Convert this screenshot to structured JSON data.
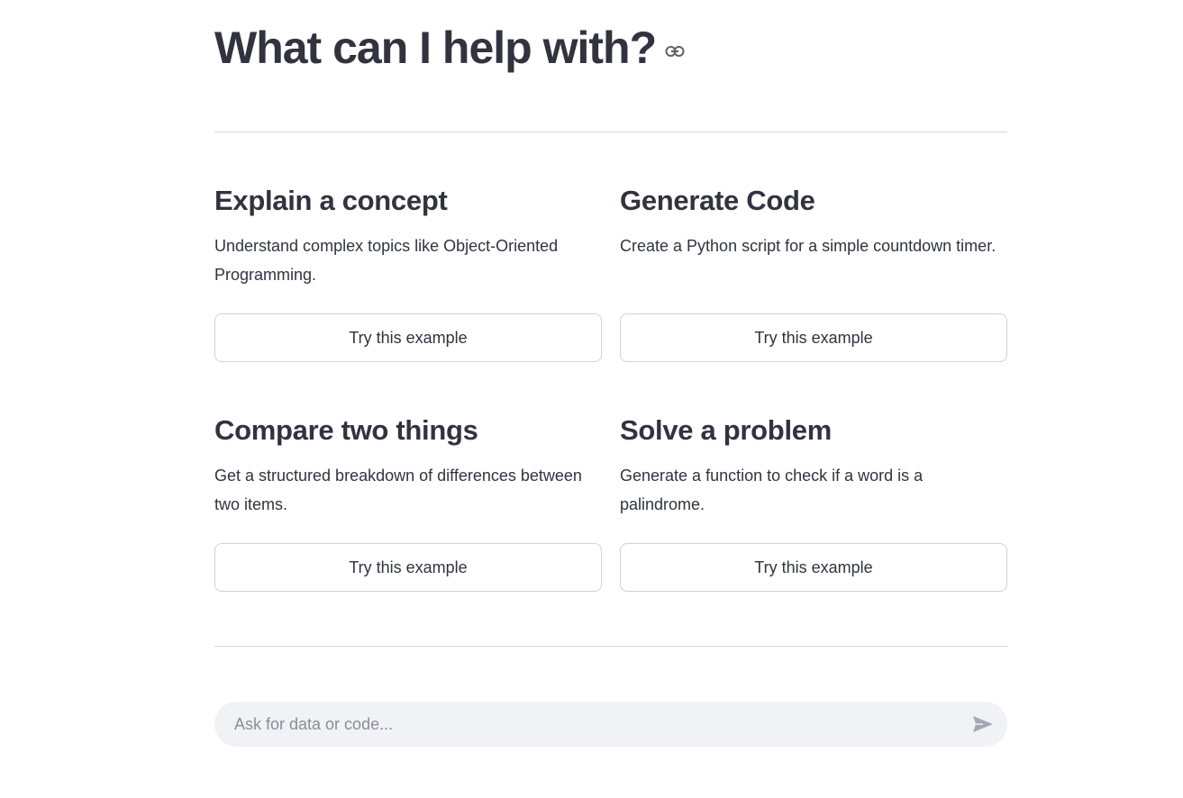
{
  "header": {
    "title": "What can I help with?",
    "anchor_icon": "link-icon"
  },
  "examples": [
    {
      "title": "Explain a concept",
      "description": "Understand complex topics like Object-Oriented Programming.",
      "button_label": "Try this example"
    },
    {
      "title": "Generate Code",
      "description": "Create a Python script for a simple countdown timer.",
      "button_label": "Try this example"
    },
    {
      "title": "Compare two things",
      "description": "Get a structured breakdown of differences between two items.",
      "button_label": "Try this example"
    },
    {
      "title": "Solve a problem",
      "description": "Generate a function to check if a word is a palindrome.",
      "button_label": "Try this example"
    }
  ],
  "chat": {
    "placeholder": "Ask for data or code...",
    "value": "",
    "send_icon": "send-icon"
  },
  "colors": {
    "text": "#31333f",
    "divider": "#d6d6d9",
    "input_background": "#f0f2f6",
    "icon": "#a3a8b4"
  }
}
